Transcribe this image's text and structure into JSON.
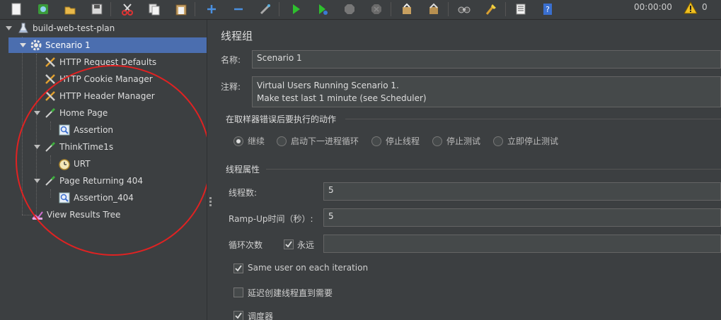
{
  "toolbar": {
    "timer": "00:00:00",
    "warning_count": "0",
    "buttons": [
      "new-icon",
      "templates-icon",
      "open-icon",
      "save-icon",
      "cut-icon",
      "copy-icon",
      "paste-icon",
      "expand-icon",
      "collapse-icon",
      "toggle-icon",
      "start-icon",
      "start-no-pause-icon",
      "stop-icon",
      "shutdown-icon",
      "clear-icon",
      "clear-all-icon",
      "search-icon",
      "reset-search-icon",
      "function-helper-icon",
      "help-icon"
    ]
  },
  "tree": {
    "items": [
      {
        "label": "build-web-test-plan",
        "icon": "test-plan-icon"
      },
      {
        "label": "Scenario 1",
        "icon": "gear-icon"
      },
      {
        "label": "HTTP Request Defaults",
        "icon": "wrench-icon"
      },
      {
        "label": "HTTP Cookie Manager",
        "icon": "wrench-icon"
      },
      {
        "label": "HTTP Header Manager",
        "icon": "wrench-icon"
      },
      {
        "label": "Home Page",
        "icon": "pipette-icon"
      },
      {
        "label": "Assertion",
        "icon": "magnifier-icon"
      },
      {
        "label": "ThinkTime1s",
        "icon": "pipette-icon"
      },
      {
        "label": "URT",
        "icon": "timer-icon"
      },
      {
        "label": "Page Returning 404",
        "icon": "pipette-icon"
      },
      {
        "label": "Assertion_404",
        "icon": "magnifier-icon"
      },
      {
        "label": "View Results Tree",
        "icon": "chart-icon"
      }
    ]
  },
  "panel": {
    "title": "线程组",
    "name_label": "名称:",
    "name_value": "Scenario 1",
    "comment_label": "注释:",
    "comment_lines": [
      "Virtual Users Running Scenario 1.",
      "Make test last 1 minute (see Scheduler)"
    ],
    "error_section": "在取样器错误后要执行的动作",
    "error_options": [
      "继续",
      "启动下一进程循环",
      "停止线程",
      "停止测试",
      "立即停止测试"
    ],
    "thread_section": "线程属性",
    "threads_label": "线程数:",
    "threads_value": "5",
    "rampup_label": "Ramp-Up时间（秒）:",
    "rampup_value": "5",
    "loop_label": "循环次数",
    "forever_label": "永远",
    "loop_value": "",
    "same_user_label": "Same user on each iteration",
    "delay_label": "延迟创建线程直到需要",
    "scheduler_label": "调度器"
  }
}
